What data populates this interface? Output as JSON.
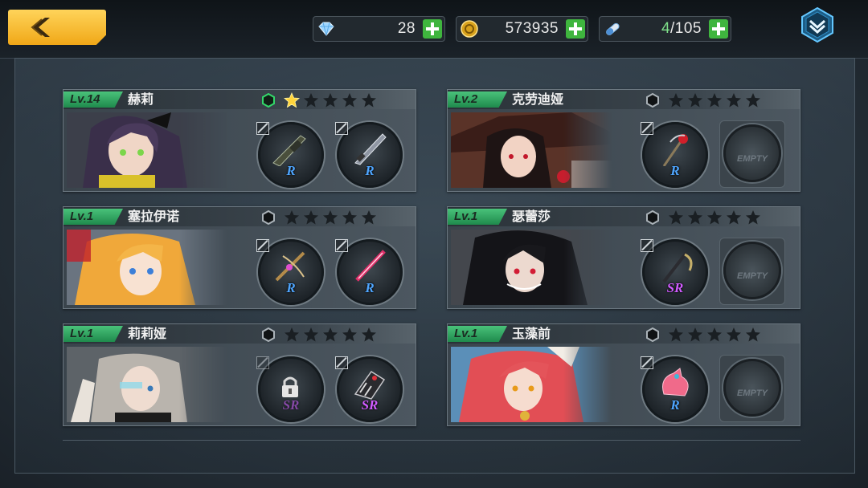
{
  "resources": {
    "gems": "28",
    "gold": "573935",
    "stamina_current": "4",
    "stamina_max": "/105"
  },
  "colors": {
    "accent_yellow": "#f0a717",
    "level_green": "#2faa5f",
    "rarity_r": "#4fa6ff",
    "rarity_sr": "#d05cff",
    "plus_green": "#3fb53e"
  },
  "characters": [
    {
      "level": "Lv.14",
      "name": "赫莉",
      "stars": 1,
      "grade": "green",
      "slots": [
        {
          "rarity": "R",
          "weapon": "rifle"
        },
        {
          "rarity": "R",
          "weapon": "blade"
        }
      ]
    },
    {
      "level": "Lv.2",
      "name": "克劳迪娅",
      "stars": 0,
      "grade": "gray",
      "slots": [
        {
          "rarity": "R",
          "weapon": "rose-staff"
        },
        {
          "empty": "EMPTY"
        }
      ]
    },
    {
      "level": "Lv.1",
      "name": "塞拉伊诺",
      "stars": 0,
      "grade": "gray",
      "slots": [
        {
          "rarity": "R",
          "weapon": "crossbow"
        },
        {
          "rarity": "R",
          "weapon": "sword"
        }
      ]
    },
    {
      "level": "Lv.1",
      "name": "瑟蕾莎",
      "stars": 0,
      "grade": "gray",
      "slots": [
        {
          "rarity": "SR",
          "weapon": "scythe"
        },
        {
          "empty": "EMPTY"
        }
      ]
    },
    {
      "level": "Lv.1",
      "name": "莉莉娅",
      "stars": 0,
      "grade": "gray",
      "slots": [
        {
          "rarity": "SR",
          "weapon": "locked"
        },
        {
          "rarity": "SR",
          "weapon": "gauntlet"
        }
      ]
    },
    {
      "level": "Lv.1",
      "name": "玉藻前",
      "stars": 0,
      "grade": "gray",
      "slots": [
        {
          "rarity": "R",
          "weapon": "pink-orb"
        },
        {
          "empty": "EMPTY"
        }
      ]
    }
  ]
}
